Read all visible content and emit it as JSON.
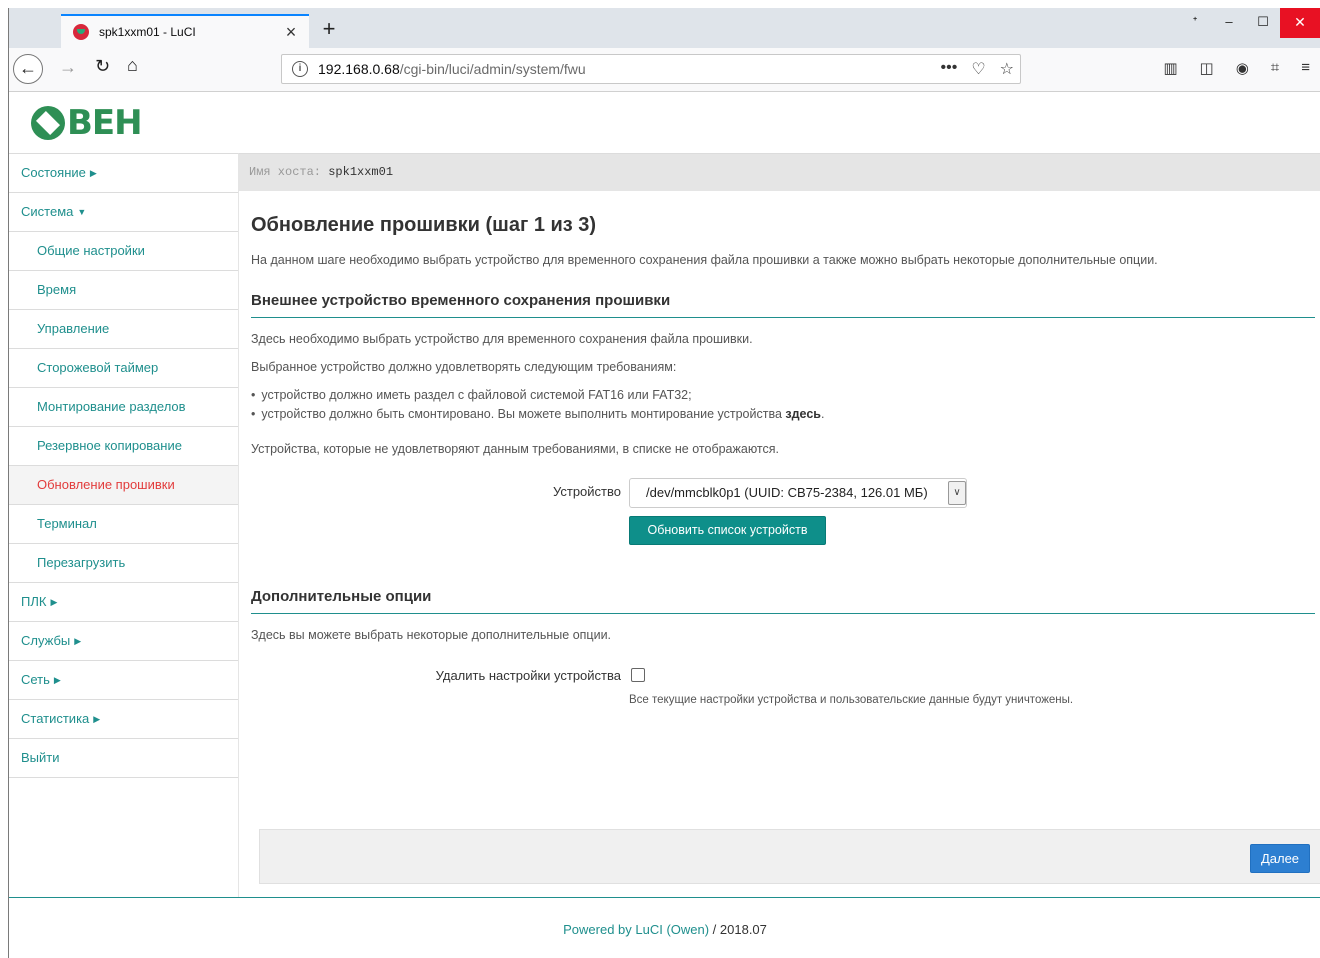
{
  "browser": {
    "tab_title": "spk1xxm01 - LuCI",
    "tab_close": "×",
    "new_tab": "+",
    "url_host": "192.168.0.68",
    "url_path": "/cgi-bin/luci/admin/system/fwu",
    "url_actions": [
      "•••",
      "♡",
      "☆"
    ],
    "win_controls": [
      "ᐩ",
      "–",
      "☐",
      "✕"
    ]
  },
  "logo_text": "ВЕН",
  "host": {
    "label": "Имя хоста:",
    "value": "spk1xxm01"
  },
  "sidebar": {
    "items": [
      {
        "label": "Состояние",
        "caret": "▶"
      },
      {
        "label": "Система",
        "caret": "▼"
      },
      {
        "label": "Общие настройки"
      },
      {
        "label": "Время"
      },
      {
        "label": "Управление"
      },
      {
        "label": "Сторожевой таймер"
      },
      {
        "label": "Монтирование разделов"
      },
      {
        "label": "Резервное копирование"
      },
      {
        "label": "Обновление прошивки"
      },
      {
        "label": "Терминал"
      },
      {
        "label": "Перезагрузить"
      },
      {
        "label": "ПЛК",
        "caret": "▶"
      },
      {
        "label": "Службы",
        "caret": "▶"
      },
      {
        "label": "Сеть",
        "caret": "▶"
      },
      {
        "label": "Статистика",
        "caret": "▶"
      },
      {
        "label": "Выйти"
      }
    ]
  },
  "main": {
    "title": "Обновление прошивки (шаг 1 из 3)",
    "description": "На данном шаге необходимо выбрать устройство для временного сохранения файла прошивки а также можно выбрать некоторые дополнительные опции.",
    "section1": {
      "title": "Внешнее устройство временного сохранения прошивки",
      "p1": "Здесь необходимо выбрать устройство для временного сохранения файла прошивки.",
      "p2": "Выбранное устройство должно удовлетворять следующим требованиям:",
      "req1": "устройство должно иметь раздел с файловой системой FAT16 или FAT32;",
      "req2_text": "устройство должно быть смонтировано. Вы можете выполнить монтирование устройства ",
      "req2_link": "здесь",
      "req2_end": ".",
      "bullet": "•",
      "note": "Устройства, которые не удовлетворяют данным требованиями, в списке не отображаются.",
      "device_label": "Устройство",
      "device_value": "/dev/mmcblk0p1 (UUID: CB75-2384, 126.01 МБ)",
      "refresh_button": "Обновить список устройств"
    },
    "section2": {
      "title": "Дополнительные опции",
      "p1": "Здесь вы можете выбрать некоторые дополнительные опции.",
      "reset_label": "Удалить настройки устройства",
      "reset_checked": false,
      "reset_help": "Все текущие настройки устройства и пользовательские данные будут уничтожены."
    },
    "next_button": "Далее"
  },
  "footer": {
    "link": "Powered by LuCI (Owen)",
    "version": " / 2018.07"
  }
}
